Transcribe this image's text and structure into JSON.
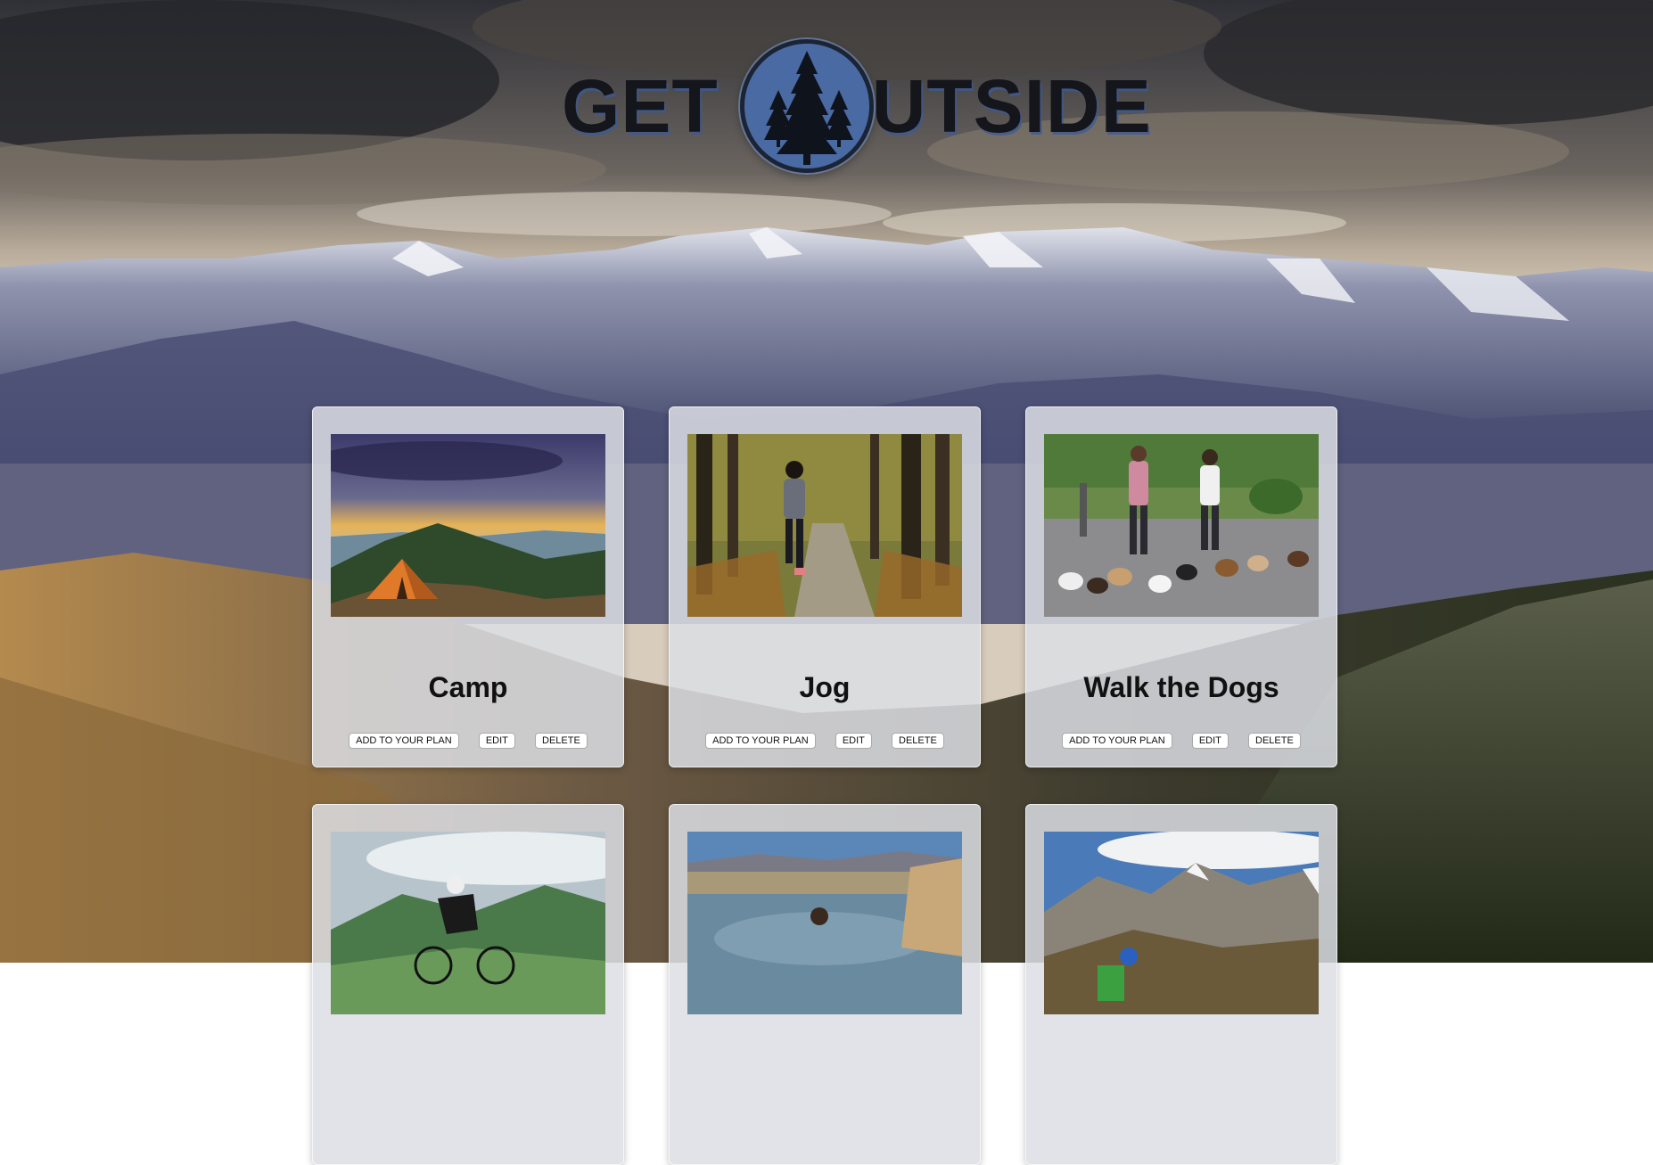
{
  "header": {
    "logo_word_left": "GET",
    "logo_word_right": "UTSIDE",
    "logo_icon": "pine-trees-icon"
  },
  "activities": [
    {
      "title": "Camp",
      "image": "tent-sunset-photo",
      "add_label": "ADD TO YOUR PLAN",
      "edit_label": "EDIT",
      "delete_label": "DELETE"
    },
    {
      "title": "Jog",
      "image": "forest-runner-photo",
      "add_label": "ADD TO YOUR PLAN",
      "edit_label": "EDIT",
      "delete_label": "DELETE"
    },
    {
      "title": "Walk the Dogs",
      "image": "dog-walkers-photo",
      "add_label": "ADD TO YOUR PLAN",
      "edit_label": "EDIT",
      "delete_label": "DELETE"
    },
    {
      "title": "",
      "image": "cyclist-photo",
      "add_label": "",
      "edit_label": "",
      "delete_label": ""
    },
    {
      "title": "",
      "image": "hot-spring-photo",
      "add_label": "",
      "edit_label": "",
      "delete_label": ""
    },
    {
      "title": "",
      "image": "mountain-hiker-photo",
      "add_label": "",
      "edit_label": "",
      "delete_label": ""
    }
  ],
  "colors": {
    "logo_text": "#14161c",
    "logo_badge": "#4a6aa3",
    "card_bg": "#dcdee4"
  }
}
